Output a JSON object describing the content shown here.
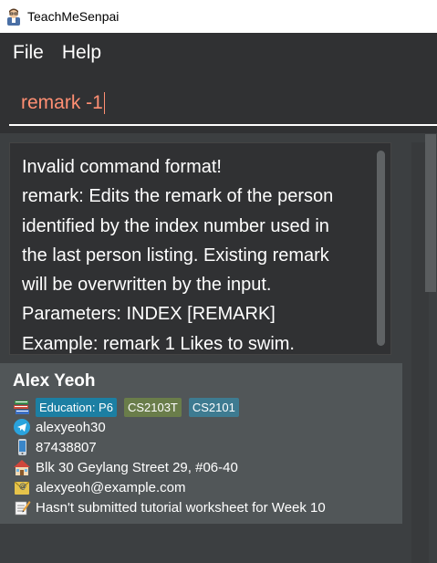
{
  "window": {
    "title": "TeachMeSenpai",
    "icon": "teacher-avatar-icon"
  },
  "menu": {
    "items": [
      "File",
      "Help"
    ]
  },
  "command": {
    "value": "remark -1",
    "text_color": "#ff8f73"
  },
  "result": {
    "lines": [
      "Invalid command format!",
      "remark: Edits the remark of the person",
      "identified by the index number used in",
      "the last person listing. Existing remark",
      "will be overwritten by the input.",
      "Parameters: INDEX [REMARK]",
      "Example: remark 1 Likes to swim."
    ]
  },
  "students": [
    {
      "name": "Alex Yeoh",
      "tags": [
        {
          "label": "Education: P6",
          "color": "#1c7fa3"
        },
        {
          "label": "CS2103T",
          "color": "#6a7d4a"
        },
        {
          "label": "CS2101",
          "color": "#3e7b91"
        }
      ],
      "telegram": "alexyeoh30",
      "phone": "87438807",
      "address": "Blk 30 Geylang Street 29, #06-40",
      "email": "alexyeoh@example.com",
      "remark": "Hasn't submitted tutorial worksheet for Week 10"
    }
  ],
  "icons": {
    "tags": "books-icon",
    "telegram": "telegram-icon",
    "phone": "phone-icon",
    "address": "house-icon",
    "email": "email-icon",
    "remark": "memo-icon"
  }
}
